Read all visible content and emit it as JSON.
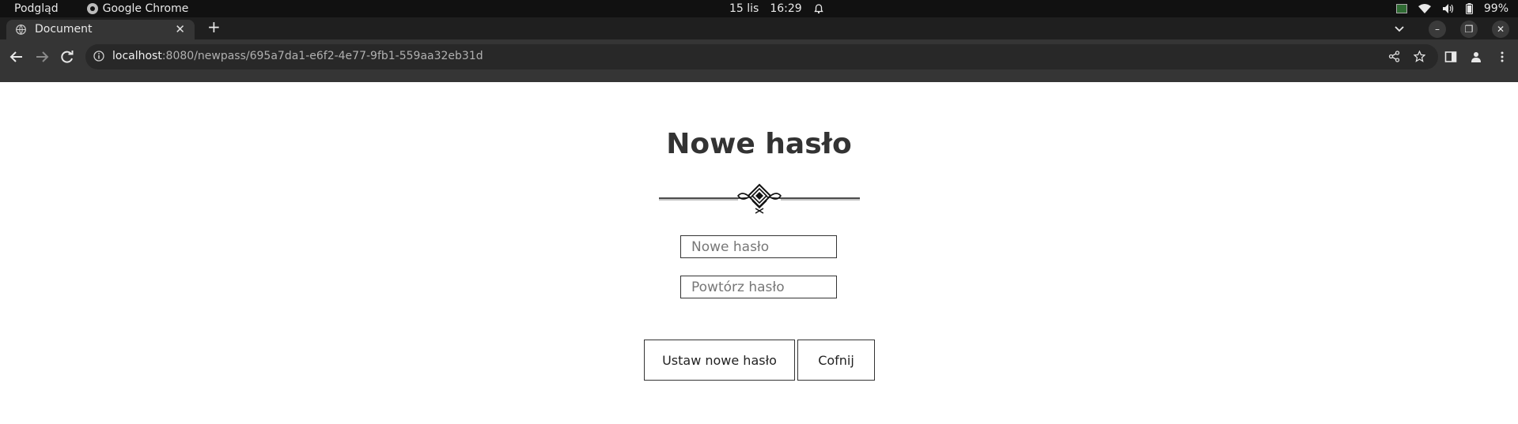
{
  "system_bar": {
    "app_menu": "Podgląd",
    "active_app": "Google Chrome",
    "date": "15 lis",
    "time": "16:29",
    "battery": "99%"
  },
  "browser": {
    "tab_title": "Document",
    "url_host": "localhost",
    "url_rest": ":8080/newpass/695a7da1-e6f2-4e77-9fb1-559aa32eb31d"
  },
  "page": {
    "heading": "Nowe hasło",
    "new_password_placeholder": "Nowe hasło",
    "repeat_password_placeholder": "Powtórz hasło",
    "submit_label": "Ustaw nowe hasło",
    "back_label": "Cofnij"
  },
  "colors": {
    "system_bar": "#111111",
    "tab_strip": "#1f1f1f",
    "toolbar": "#353535",
    "heading": "#333333"
  }
}
